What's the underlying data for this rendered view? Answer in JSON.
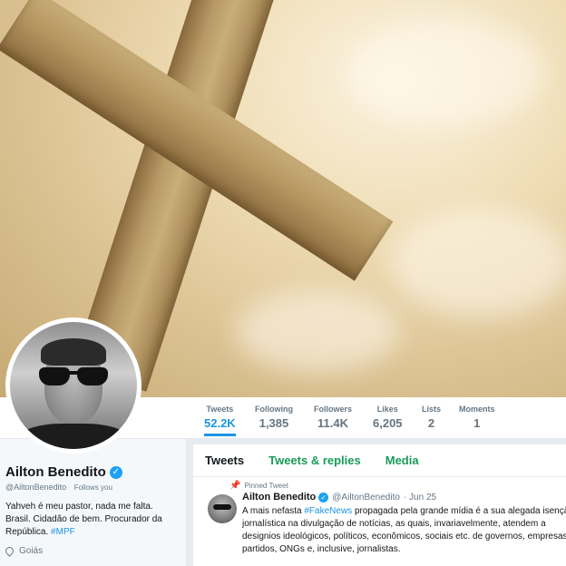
{
  "profile": {
    "name": "Ailton Benedito",
    "handle": "@AiltonBenedito",
    "follows_you": "Follows you",
    "bio_lines": [
      "Yahveh é meu pastor, nada me falta.",
      "Brasil. Cidadão de bem. Procurador da",
      "República."
    ],
    "bio_hashtag": "#MPF",
    "location": "Goiás"
  },
  "stats": [
    {
      "label": "Tweets",
      "value": "52.2K"
    },
    {
      "label": "Following",
      "value": "1,385"
    },
    {
      "label": "Followers",
      "value": "11.4K"
    },
    {
      "label": "Likes",
      "value": "6,205"
    },
    {
      "label": "Lists",
      "value": "2"
    },
    {
      "label": "Moments",
      "value": "1"
    }
  ],
  "tabs": [
    "Tweets",
    "Tweets & replies",
    "Media"
  ],
  "pinned_tweet": {
    "label": "Pinned Tweet",
    "name": "Ailton Benedito",
    "handle": "@AiltonBenedito",
    "date": "· Jun 25",
    "text_prefix": "A mais nefasta ",
    "hashtag": "#FakeNews",
    "text_suffix": " propagada pela grande mídia é a sua alegada isenção",
    "lines": [
      "jornalística na divulgação de notícias, as quais, invariavelmente, atendem a",
      "designios ideológicos, políticos, econômicos, sociais etc. de governos, empresas,",
      "partidos, ONGs e, inclusive, jornalistas."
    ]
  },
  "colors": {
    "accent": "#1b95e0",
    "tab_green": "#1a9b58",
    "verified": "#1da1f2"
  },
  "icons": [
    "verified-badge-icon",
    "location-pin-icon",
    "pin-icon"
  ]
}
